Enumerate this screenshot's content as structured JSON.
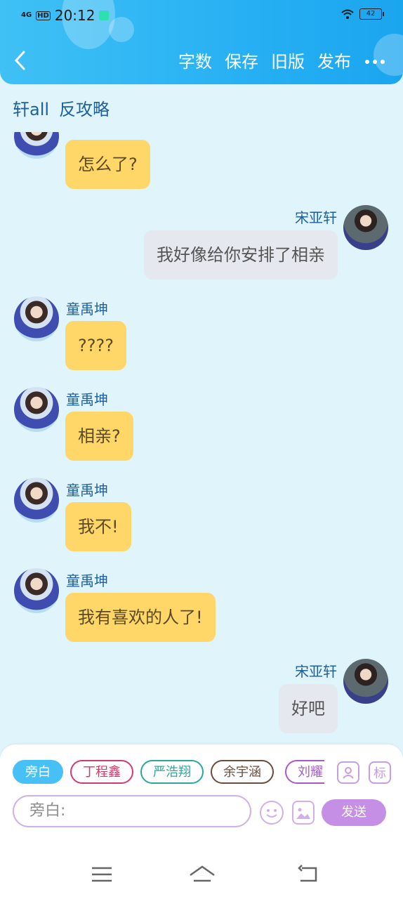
{
  "status": {
    "network": "4G",
    "hd": "HD",
    "time": "20:12",
    "battery": "42"
  },
  "header": {
    "back_icon": "chevron-left-icon",
    "actions": [
      "字数",
      "保存",
      "旧版",
      "发布"
    ],
    "more_icon": "more-dots-icon"
  },
  "subtitle": {
    "part1": "轩all",
    "part2": "反攻略"
  },
  "messages": [
    {
      "side": "left",
      "name": "",
      "text": "怎么了?"
    },
    {
      "side": "right",
      "name": "宋亚轩",
      "text": "我好像给你安排了相亲"
    },
    {
      "side": "left",
      "name": "童禹坤",
      "text": "????"
    },
    {
      "side": "left",
      "name": "童禹坤",
      "text": "相亲?"
    },
    {
      "side": "left",
      "name": "童禹坤",
      "text": "我不!"
    },
    {
      "side": "left",
      "name": "童禹坤",
      "text": "我有喜欢的人了!"
    },
    {
      "side": "right",
      "name": "宋亚轩",
      "text": "好吧"
    }
  ],
  "composer": {
    "chips": [
      "旁白",
      "丁程鑫",
      "严浩翔",
      "余宇涵",
      "刘耀"
    ],
    "contact_icon": "person-icon",
    "tag_label": "标",
    "placeholder": "旁白:",
    "emoji_icon": "emoji-icon",
    "image_icon": "image-icon",
    "send_label": "发送"
  },
  "system_nav": {
    "menu_icon": "menu-icon",
    "home_icon": "home-icon",
    "back_icon": "back-icon"
  },
  "colors": {
    "header": "#27b0f3",
    "bubble_left": "#ffd768",
    "bubble_right": "#e6e8ef",
    "send": "#c68fe6"
  }
}
